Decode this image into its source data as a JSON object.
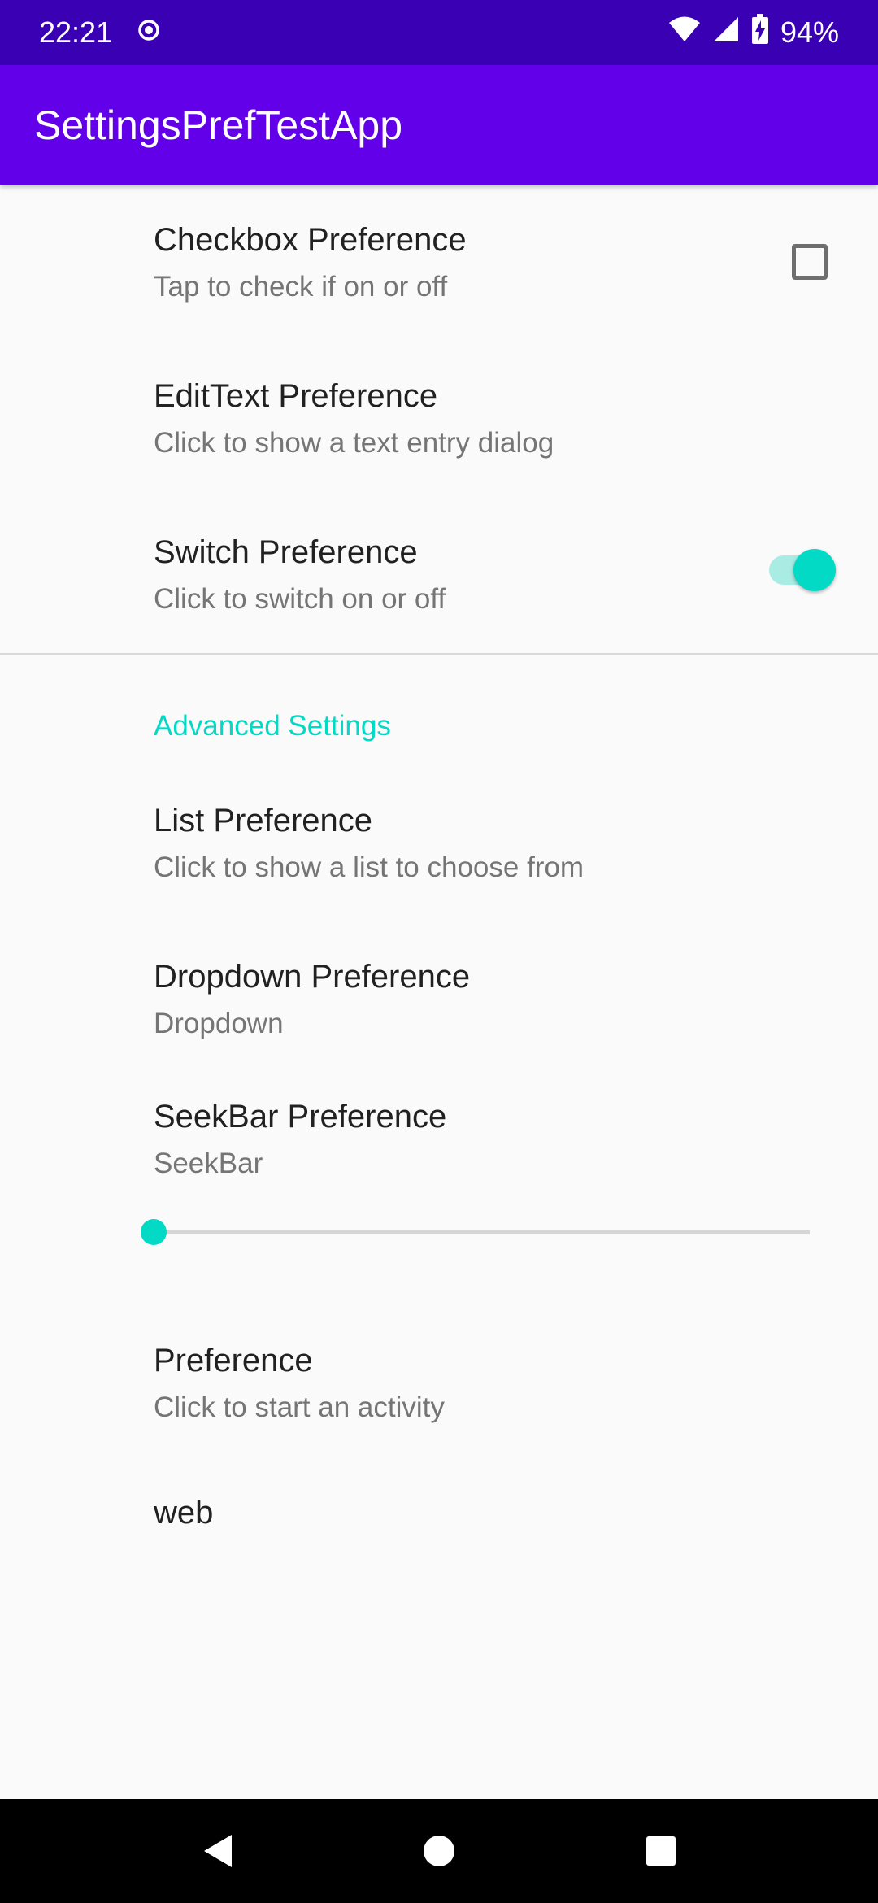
{
  "status_bar": {
    "time": "22:21",
    "battery": "94%",
    "icons": [
      "record-icon",
      "wifi-icon",
      "signal-icon",
      "battery-charging-icon"
    ]
  },
  "app_bar": {
    "title": "SettingsPrefTestApp"
  },
  "preferences": {
    "checkbox": {
      "title": "Checkbox Preference",
      "summary": "Tap to check if on or off",
      "checked": false
    },
    "edittext": {
      "title": "EditText Preference",
      "summary": "Click to show a text entry dialog"
    },
    "switch": {
      "title": "Switch Preference",
      "summary": "Click to switch on or off",
      "on": true
    },
    "category": {
      "title": "Advanced Settings"
    },
    "list": {
      "title": "List Preference",
      "summary": "Click to show a list to choose from"
    },
    "dropdown": {
      "title": "Dropdown Preference",
      "summary": "Dropdown"
    },
    "seekbar": {
      "title": "SeekBar Preference",
      "summary": "SeekBar",
      "value_fraction": 0.0
    },
    "activity": {
      "title": "Preference",
      "summary": "Click to start an activity"
    },
    "web": {
      "title": "web"
    }
  },
  "colors": {
    "status_bar": "#3a00b3",
    "app_bar": "#6200ea",
    "accent": "#03dac5",
    "background": "#fafafa"
  },
  "nav_bar": {
    "icons": [
      "back-icon",
      "home-icon",
      "recents-icon"
    ]
  }
}
